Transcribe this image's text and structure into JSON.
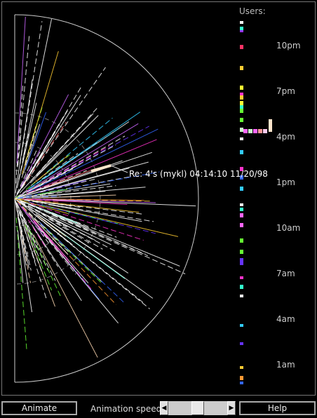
{
  "users_label": "Users:",
  "time_ticks": [
    "10pm",
    "7pm",
    "4pm",
    "1pm",
    "10am",
    "7am",
    "4am",
    "1am"
  ],
  "tooltip": "Re: 4's (mykl) 04:14:10 11/20/98",
  "controls": {
    "animate_label": "Animate",
    "speed_label": "Animation speed:",
    "speed_value": 0.5,
    "help_label": "Help",
    "left_arrow": "◀",
    "right_arrow": "▶"
  },
  "colors": {
    "background": "#000000",
    "arc": "#cccccc",
    "text": "#dddddd"
  },
  "palette": [
    "#ffffff",
    "#ff33cc",
    "#33ffcc",
    "#6633ff",
    "#ffcc33",
    "#66ff33",
    "#ff6666",
    "#3366ff",
    "#ffd9b3",
    "#cc66ff",
    "#33ccff",
    "#ff9933"
  ]
}
